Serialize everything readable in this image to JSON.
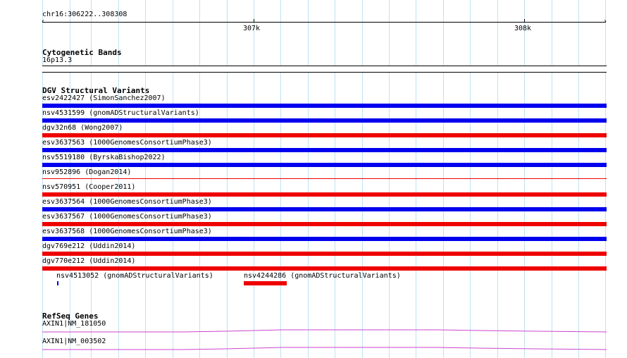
{
  "ruler": {
    "region": "chr16:306222..308308",
    "major_ticks": [
      "307k",
      "308k"
    ]
  },
  "colors": {
    "grid": "#bfe3ee",
    "variant_blue": "#0000ee",
    "variant_red": "#ee0000",
    "gene": "#cc44cc"
  },
  "tracks": {
    "cytogenetic": {
      "title": "Cytogenetic Bands",
      "band": "16p13.3"
    },
    "dgv": {
      "title": "DGV Structural Variants",
      "items": [
        {
          "label": "esv2422427 (SimonSanchez2007)",
          "color": "blue"
        },
        {
          "label": "nsv4531599 (gnomADStructuralVariants)",
          "color": "blue"
        },
        {
          "label": "dgv32n68 (Wong2007)",
          "color": "red"
        },
        {
          "label": "esv3637563 (1000GenomesConsortiumPhase3)",
          "color": "blue"
        },
        {
          "label": "nsv5519180 (ByrskaBishop2022)",
          "color": "blue"
        },
        {
          "label": "nsv952896 (Dogan2014)",
          "color": "red-thin"
        },
        {
          "label": "nsv570951 (Cooper2011)",
          "color": "red"
        },
        {
          "label": "esv3637564 (1000GenomesConsortiumPhase3)",
          "color": "blue"
        },
        {
          "label": "esv3637567 (1000GenomesConsortiumPhase3)",
          "color": "red"
        },
        {
          "label": "esv3637568 (1000GenomesConsortiumPhase3)",
          "color": "blue"
        },
        {
          "label": "dgv769e212 (Uddin2014)",
          "color": "red"
        },
        {
          "label": "dgv770e212 (Uddin2014)",
          "color": "red"
        }
      ],
      "small_items": [
        {
          "label": "nsv4513052 (gnomADStructuralVariants)",
          "color": "blue"
        },
        {
          "label": "nsv4244286 (gnomADStructuralVariants)",
          "color": "red"
        }
      ]
    },
    "refseq": {
      "title": "RefSeq Genes",
      "genes": [
        {
          "label": "AXIN1|NM_181050"
        },
        {
          "label": "AXIN1|NM_003502"
        }
      ]
    }
  }
}
